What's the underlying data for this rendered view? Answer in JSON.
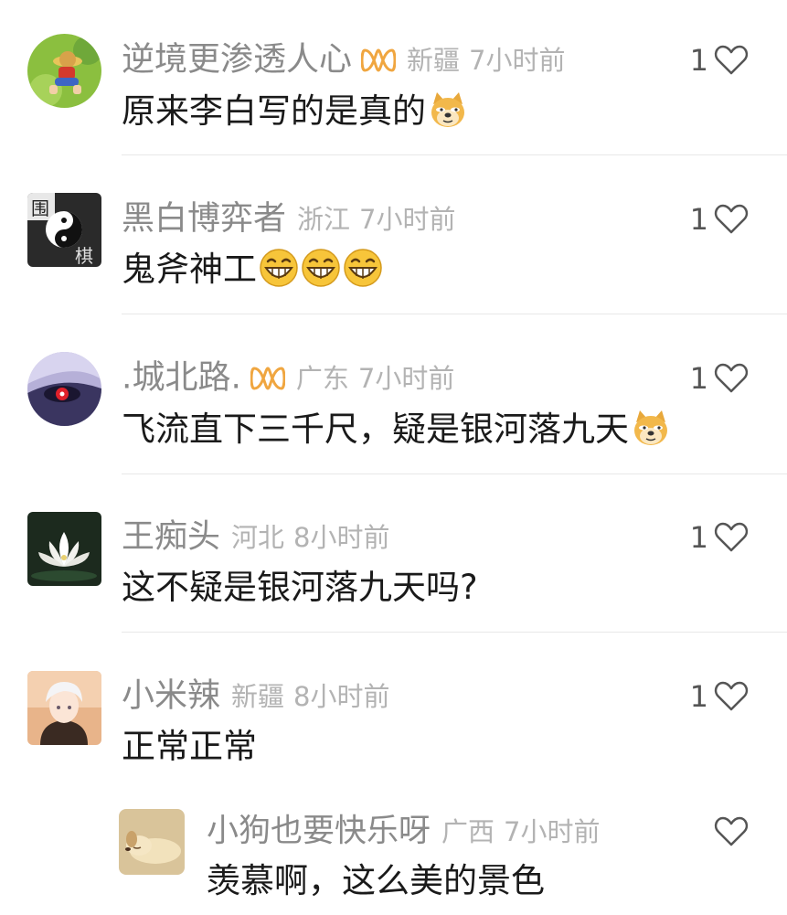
{
  "colors": {
    "username": "#8a8a8a",
    "meta": "#b3b3b3",
    "text": "#1a1a1a",
    "vip_badge": "#f0a640",
    "divider": "#e8e8e8"
  },
  "comments": [
    {
      "avatar_icon": "cartoon-boy-avatar",
      "username": "逆境更渗透人心",
      "vip": true,
      "region": "新疆",
      "time": "7小时前",
      "text": "原来李白写的是真的",
      "emojis": [
        "doge-emoji"
      ],
      "likes": "1"
    },
    {
      "avatar_icon": "yin-yang-weiqi-avatar",
      "username": "黑白博弈者",
      "vip": false,
      "region": "浙江",
      "time": "7小时前",
      "text": "鬼斧神工",
      "emojis": [
        "grin-emoji",
        "grin-emoji",
        "grin-emoji"
      ],
      "likes": "1"
    },
    {
      "avatar_icon": "anime-red-eye-avatar",
      "username": ".城北路.",
      "vip": true,
      "region": "广东",
      "time": "7小时前",
      "text": "飞流直下三千尺，疑是银河落九天",
      "emojis": [
        "doge-emoji"
      ],
      "likes": "1"
    },
    {
      "avatar_icon": "white-lotus-avatar",
      "username": "王痴头",
      "vip": false,
      "region": "河北",
      "time": "8小时前",
      "text": "这不疑是银河落九天吗?",
      "emojis": [],
      "likes": "1"
    },
    {
      "avatar_icon": "anime-boy-avatar",
      "username": "小米辣",
      "vip": false,
      "region": "新疆",
      "time": "8小时前",
      "text": "正常正常",
      "emojis": [],
      "likes": "1"
    }
  ],
  "reply": {
    "avatar_icon": "sleeping-dog-avatar",
    "username": "小狗也要快乐呀",
    "region": "广西",
    "time": "7小时前",
    "text": "羡慕啊，这么美的景色",
    "likes": ""
  }
}
